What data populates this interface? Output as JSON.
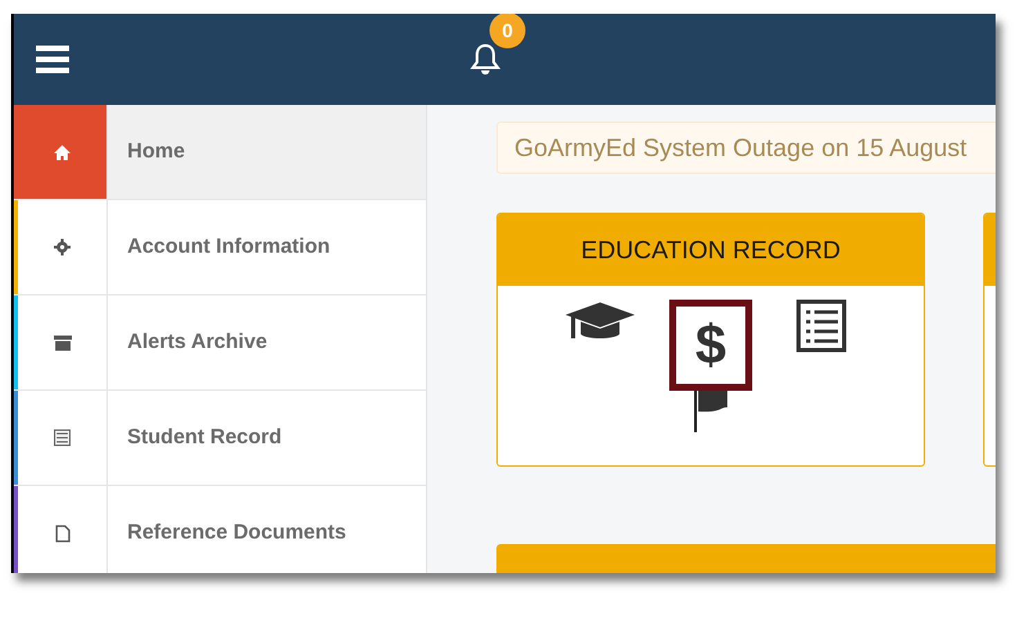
{
  "header": {
    "notification_count": "0"
  },
  "sidebar": {
    "items": [
      {
        "label": "Home",
        "kind": "home",
        "color": "#e04b2e",
        "selected": true
      },
      {
        "label": "Account Information",
        "kind": "gear",
        "color": "#f3b300",
        "selected": false
      },
      {
        "label": "Alerts Archive",
        "kind": "archive",
        "color": "#14c0f0",
        "selected": false
      },
      {
        "label": "Student Record",
        "kind": "list",
        "color": "#3a8fd8",
        "selected": false
      },
      {
        "label": "Reference Documents",
        "kind": "document",
        "color": "#7a4fc8",
        "selected": false
      }
    ]
  },
  "alert": {
    "text": "GoArmyEd System Outage on 15 August"
  },
  "cards": [
    {
      "title": "EDUCATION RECORD",
      "icons": [
        {
          "kind": "cap",
          "highlighted": false
        },
        {
          "kind": "dollar",
          "symbol": "$",
          "highlighted": true
        },
        {
          "kind": "list",
          "highlighted": false
        },
        {
          "kind": "flag",
          "highlighted": false
        }
      ]
    }
  ]
}
